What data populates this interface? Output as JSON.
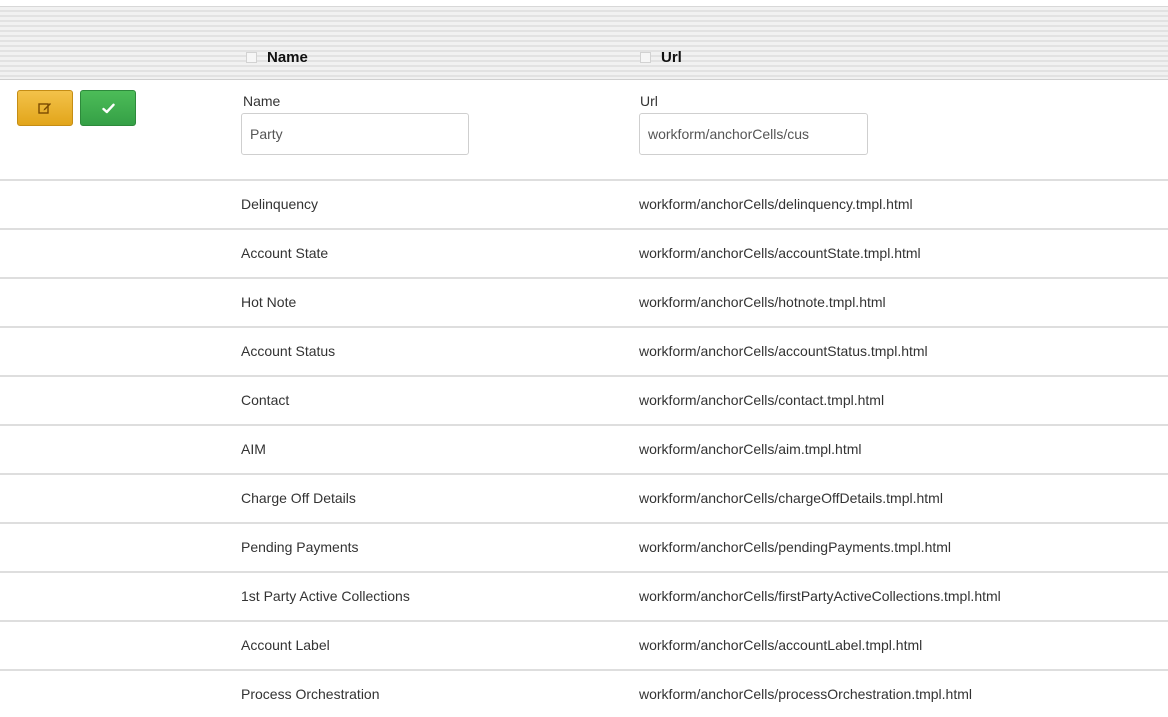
{
  "header": {
    "name_label": "Name",
    "url_label": "Url"
  },
  "edit_row": {
    "name_field_label": "Name",
    "name_value": "Party",
    "url_field_label": "Url",
    "url_value": "workform/anchorCells/cus",
    "edit_icon": "pencil-square-icon",
    "save_icon": "checkmark-icon"
  },
  "rows": [
    {
      "name": "Delinquency",
      "url": "workform/anchorCells/delinquency.tmpl.html"
    },
    {
      "name": "Account State",
      "url": "workform/anchorCells/accountState.tmpl.html"
    },
    {
      "name": "Hot Note",
      "url": "workform/anchorCells/hotnote.tmpl.html"
    },
    {
      "name": "Account Status",
      "url": "workform/anchorCells/accountStatus.tmpl.html"
    },
    {
      "name": "Contact",
      "url": "workform/anchorCells/contact.tmpl.html"
    },
    {
      "name": "AIM",
      "url": "workform/anchorCells/aim.tmpl.html"
    },
    {
      "name": "Charge Off Details",
      "url": "workform/anchorCells/chargeOffDetails.tmpl.html"
    },
    {
      "name": "Pending Payments",
      "url": "workform/anchorCells/pendingPayments.tmpl.html"
    },
    {
      "name": "1st Party Active Collections",
      "url": "workform/anchorCells/firstPartyActiveCollections.tmpl.html"
    },
    {
      "name": "Account Label",
      "url": "workform/anchorCells/accountLabel.tmpl.html"
    },
    {
      "name": "Process Orchestration",
      "url": "workform/anchorCells/processOrchestration.tmpl.html"
    }
  ],
  "colors": {
    "edit_button": "#e2a51a",
    "save_button": "#35a046"
  }
}
